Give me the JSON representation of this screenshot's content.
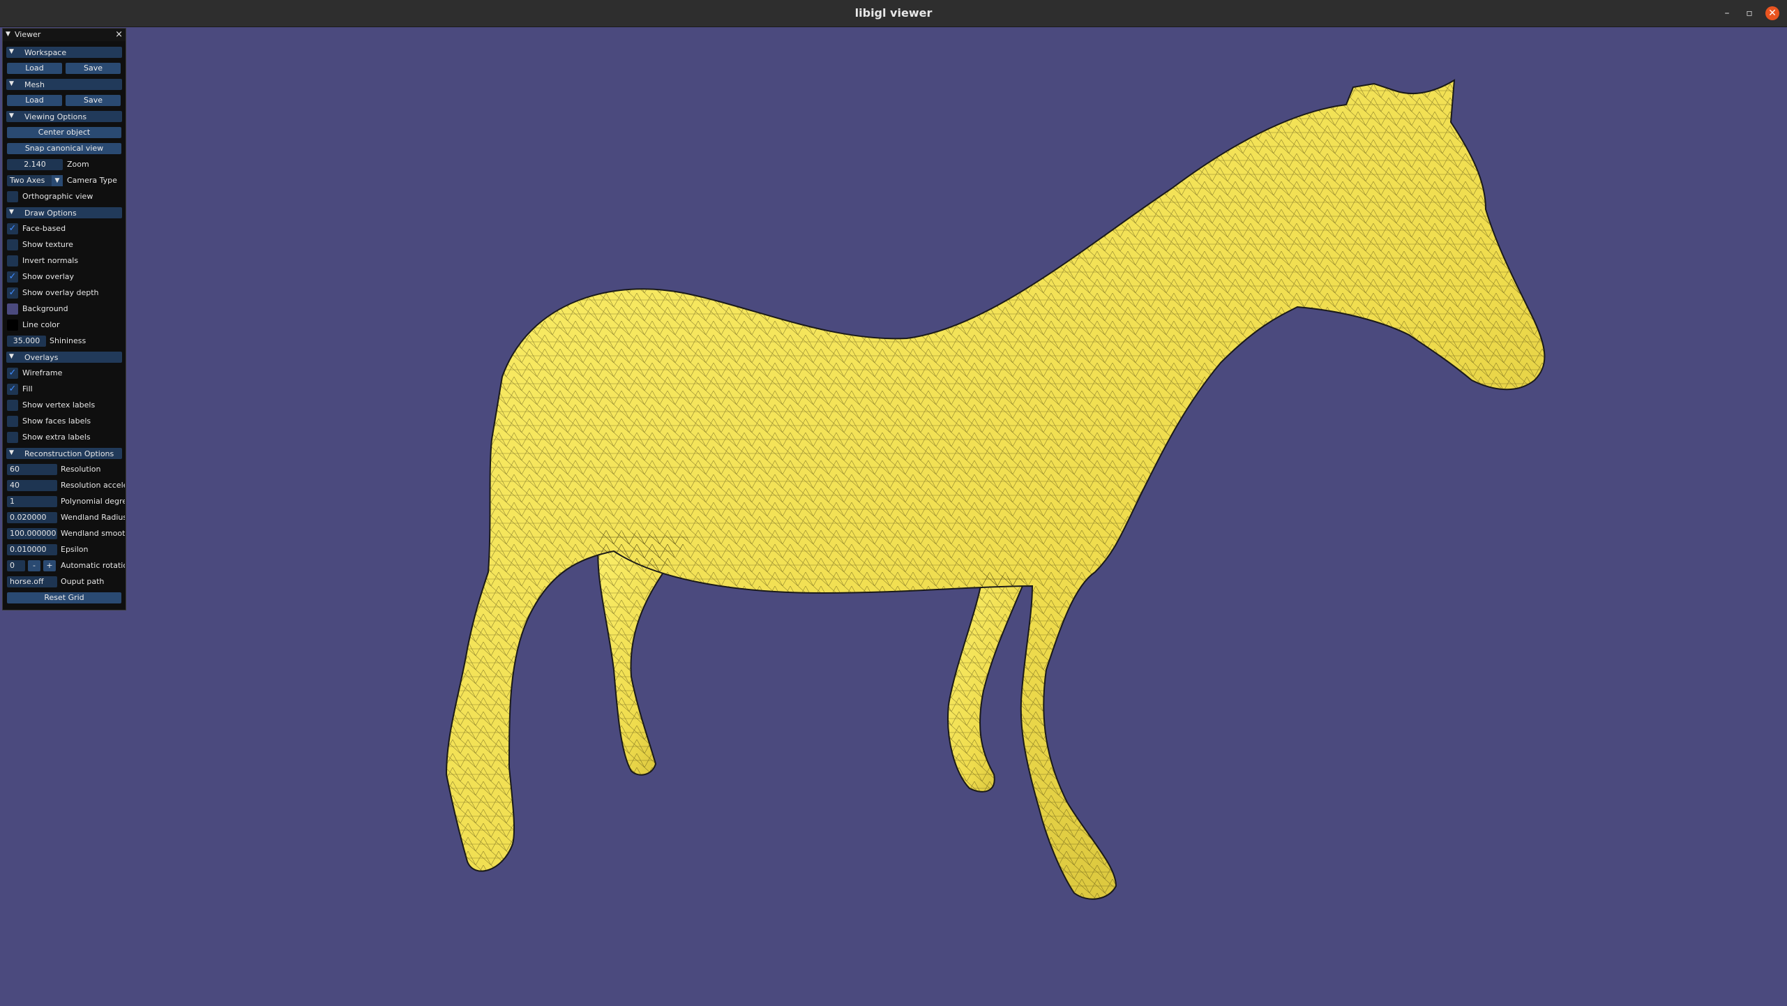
{
  "window": {
    "title": "libigl viewer",
    "minimize": "–",
    "restore": "▫",
    "close": "✕"
  },
  "colors": {
    "viewport_bg": "#4b4a7e",
    "mesh_fill": "#f2e257",
    "panel_bg": "#0f0f0f",
    "header_bg": "#213a5a",
    "button_bg": "#2a4a72",
    "check": "#3f8cff",
    "background_swatch": "#4b4a7e",
    "line_color_swatch": "#000000"
  },
  "panel": {
    "title": "Viewer",
    "close_icon": "×",
    "workspace": {
      "header": "Workspace",
      "load": "Load",
      "save": "Save"
    },
    "mesh": {
      "header": "Mesh",
      "load": "Load",
      "save": "Save"
    },
    "viewing": {
      "header": "Viewing Options",
      "center": "Center object",
      "snap": "Snap canonical view",
      "zoom_value": "2.140",
      "zoom_label": "Zoom",
      "camera_value": "Two Axes",
      "camera_label": "Camera Type",
      "ortho_label": "Orthographic view",
      "ortho_checked": false
    },
    "draw": {
      "header": "Draw Options",
      "items": [
        {
          "label": "Face-based",
          "checked": true
        },
        {
          "label": "Show texture",
          "checked": false
        },
        {
          "label": "Invert normals",
          "checked": false
        },
        {
          "label": "Show overlay",
          "checked": true
        },
        {
          "label": "Show overlay depth",
          "checked": true
        }
      ],
      "background_label": "Background",
      "line_color_label": "Line color",
      "shininess_value": "35.000",
      "shininess_label": "Shininess"
    },
    "overlays": {
      "header": "Overlays",
      "items": [
        {
          "label": "Wireframe",
          "checked": true
        },
        {
          "label": "Fill",
          "checked": true
        },
        {
          "label": "Show vertex labels",
          "checked": false
        },
        {
          "label": "Show faces labels",
          "checked": false
        },
        {
          "label": "Show extra labels",
          "checked": false
        }
      ]
    },
    "reconstruction": {
      "header": "Reconstruction Options",
      "resolution": {
        "value": "60",
        "label": "Resolution"
      },
      "resolution_accel": {
        "value": "40",
        "label": "Resolution acceler"
      },
      "poly_degree": {
        "value": "1",
        "label": "Polynomial degree"
      },
      "wendland_radius": {
        "value": "0.020000",
        "label": "Wendland Radius"
      },
      "wendland_smooth": {
        "value": "100.000000",
        "label": "Wendland smooth"
      },
      "epsilon": {
        "value": "0.010000",
        "label": "Epsilon"
      },
      "auto_rotation": {
        "value": "0",
        "minus": "-",
        "plus": "+",
        "label": "Automatic rotatior"
      },
      "output_path": {
        "value": "horse.off",
        "label": "Ouput path"
      },
      "reset": "Reset Grid"
    }
  }
}
